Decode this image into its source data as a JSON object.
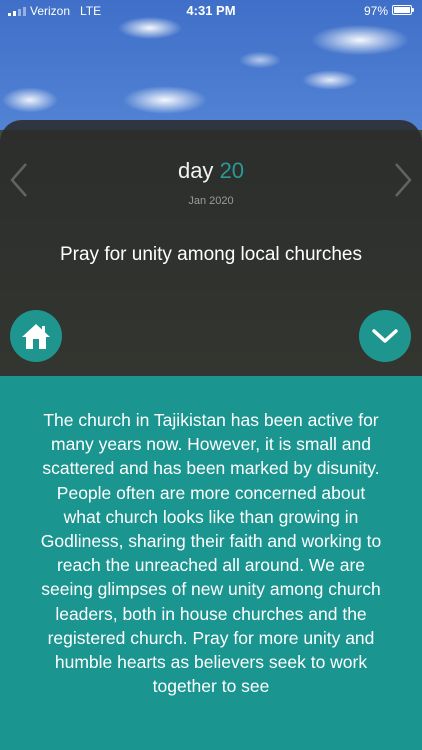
{
  "status_bar": {
    "carrier": "Verizon",
    "network": "LTE",
    "time": "4:31 PM",
    "battery": "97%"
  },
  "header": {
    "day_word": "day",
    "day_number": "20",
    "date": "Jan 2020",
    "headline": "Pray for unity among local churches"
  },
  "icons": {
    "prev": "chevron-left-icon",
    "next": "chevron-right-icon",
    "home": "home-icon",
    "expand": "chevron-down-icon"
  },
  "colors": {
    "accent": "#1f9590",
    "day_number": "#2a9a95"
  },
  "content": {
    "body": "The church in Tajikistan has been active for many years now. However, it is small and scattered and has been marked by disunity. People often are more concerned about what church looks like than growing in Godliness, sharing their faith and working to reach the unreached all around. We are seeing glimpses of new unity among church leaders, both in house churches and the registered church. Pray for more unity and humble hearts as believers seek to work together to see"
  }
}
